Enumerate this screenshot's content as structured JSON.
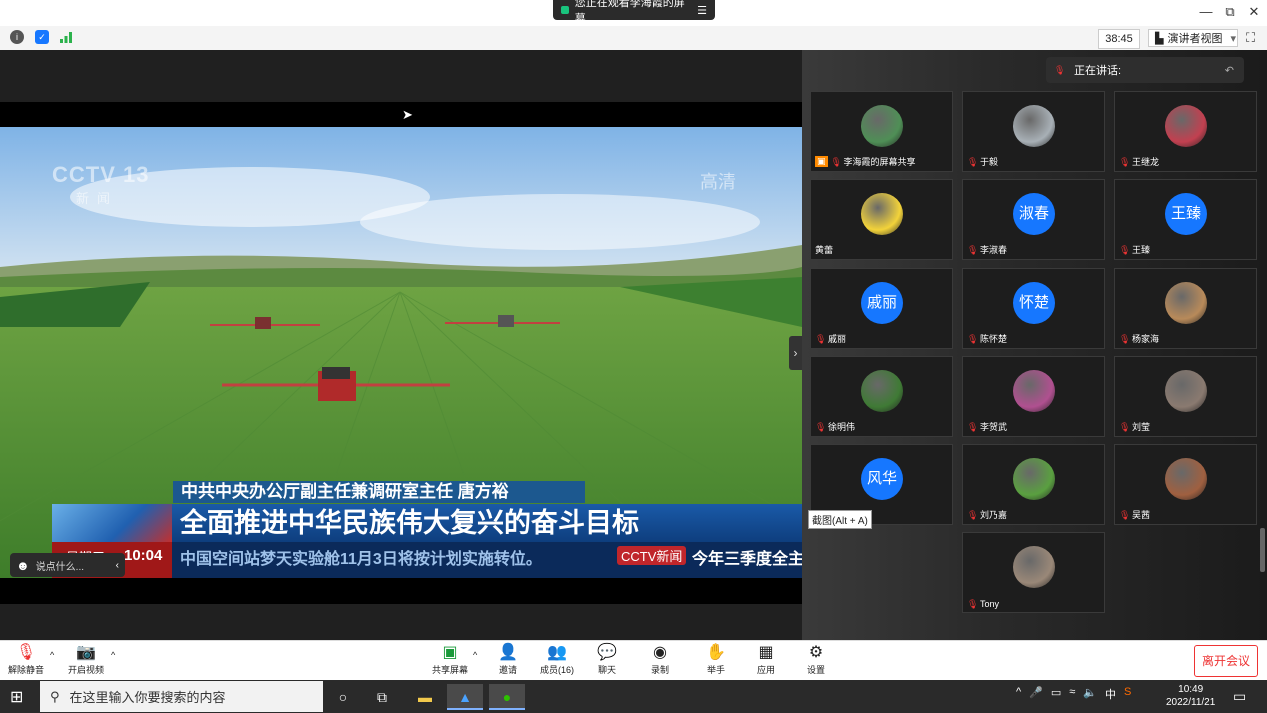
{
  "window": {
    "share_banner": "您正在观看李海霞的屏幕",
    "share_menu_icon": "menu-icon",
    "minimize": "—",
    "restore": "⧉",
    "close": "✕"
  },
  "top_toolbar": {
    "timer": "38:45",
    "view_mode": "演讲者视图",
    "view_mode_caret": "▾"
  },
  "video": {
    "channel_logo": "CCTV 13",
    "channel_sub": "新闻",
    "hd_mark": "高清",
    "name_bar": "中共中央办公厅副主任兼调研室主任 唐方裕",
    "headline": "全面推进中华民族伟大复兴的奋斗目标",
    "weekday": "星期三",
    "clock": "10:04",
    "scroll_text": "中国空间站梦天实验舱11月3日将按计划实施转位。",
    "news_tag": "CCTV新闻",
    "scroll_text2": "今年三季度全主",
    "chat_placeholder": "说点什么...",
    "chat_arrow": "‹",
    "collapse_arrow": "›"
  },
  "panel": {
    "speaking_label": "正在讲话:",
    "tooltip": "截图(Alt + A)",
    "participants": [
      {
        "name": "李海霞的屏幕共享",
        "avatar": "photo",
        "color": "#4f8f56"
      },
      {
        "name": "于毅",
        "avatar": "photo",
        "color": "#a8b0b6"
      },
      {
        "name": "王继龙",
        "avatar": "photo",
        "color": "#c24050"
      },
      {
        "name": "黄蕾",
        "avatar": "photo",
        "color": "#f3d33a"
      },
      {
        "name": "李淑春",
        "avatar_text": "淑春"
      },
      {
        "name": "王臻",
        "avatar_text": "王臻"
      },
      {
        "name": "戚丽",
        "avatar_text": "戚丽"
      },
      {
        "name": "陈怀楚",
        "avatar_text": "怀楚"
      },
      {
        "name": "杨家海",
        "avatar": "photo",
        "color": "#b88a5a"
      },
      {
        "name": "徐明伟",
        "avatar": "photo",
        "color": "#3f7a35"
      },
      {
        "name": "李贺武",
        "avatar": "photo",
        "color": "#b05090"
      },
      {
        "name": "刘莹",
        "avatar": "photo",
        "color": "#8a7a70"
      },
      {
        "name": "",
        "avatar_text": "风华"
      },
      {
        "name": "刘乃嘉",
        "avatar": "photo",
        "color": "#5aa040"
      },
      {
        "name": "吴茜",
        "avatar": "photo",
        "color": "#a06040"
      },
      {
        "name": "Tony",
        "avatar": "photo",
        "color": "#9a8878"
      }
    ]
  },
  "bottom_toolbar": {
    "unmute": "解除静音",
    "start_video": "开启视频",
    "share_screen": "共享屏幕",
    "invite": "邀请",
    "members": "成员(16)",
    "chat": "聊天",
    "record": "录制",
    "raise_hand": "举手",
    "apps": "应用",
    "settings": "设置",
    "leave": "离开会议",
    "caret": "^"
  },
  "taskbar": {
    "search_placeholder": "在这里输入你要搜索的内容",
    "tray_ime": "中",
    "time": "10:49",
    "date": "2022/11/21"
  }
}
